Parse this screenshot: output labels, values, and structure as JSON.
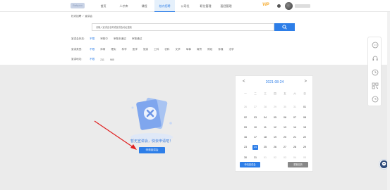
{
  "header": {
    "logo_text": "Babpoo",
    "nav": [
      "首页",
      "人才库",
      "课程",
      "校内招聘",
      "公司社",
      "职位管理",
      "面经管理"
    ],
    "active_nav_index": 3,
    "vip_label": "VIP"
  },
  "breadcrumb": [
    "校内招聘",
    "宣讲会"
  ],
  "search": {
    "placeholder": "请输入宣讲会名称或宣讲会地址搜索"
  },
  "filters": [
    {
      "label": "宣讲会状态:",
      "options": [
        "不限",
        "审核中",
        "审核未通过",
        "审核通过"
      ],
      "selected": 0
    },
    {
      "label": "宣讲类型:",
      "options": [
        "不限",
        "体育",
        "理实",
        "科学",
        "医学",
        "旅游",
        "工科",
        "农科",
        "文学",
        "军事",
        "商贸",
        "财经",
        "传媒",
        "法学"
      ],
      "selected": 0
    },
    {
      "label": "宣讲地址:",
      "options": [
        "不限",
        "211",
        "985"
      ],
      "selected": 0
    }
  ],
  "empty": {
    "message": "暂无宣讲会，快去申请吧！",
    "apply_button": "申请宣讲会"
  },
  "calendar": {
    "title": "2021-08-24",
    "prev": "<",
    "next": ">",
    "weekdays": [
      "一",
      "二",
      "三",
      "四",
      "五",
      "六",
      "日"
    ],
    "days": [
      {
        "d": "26",
        "muted": true
      },
      {
        "d": "27",
        "muted": true
      },
      {
        "d": "28",
        "muted": true
      },
      {
        "d": "29",
        "muted": true
      },
      {
        "d": "30",
        "muted": true
      },
      {
        "d": "31",
        "muted": true
      },
      {
        "d": "01"
      },
      {
        "d": "02"
      },
      {
        "d": "03"
      },
      {
        "d": "04"
      },
      {
        "d": "05"
      },
      {
        "d": "06"
      },
      {
        "d": "07"
      },
      {
        "d": "08"
      },
      {
        "d": "09"
      },
      {
        "d": "10"
      },
      {
        "d": "11"
      },
      {
        "d": "12"
      },
      {
        "d": "13"
      },
      {
        "d": "14"
      },
      {
        "d": "15"
      },
      {
        "d": "16"
      },
      {
        "d": "17"
      },
      {
        "d": "18"
      },
      {
        "d": "19"
      },
      {
        "d": "20"
      },
      {
        "d": "21"
      },
      {
        "d": "22"
      },
      {
        "d": "23"
      },
      {
        "d": "24",
        "today": true
      },
      {
        "d": "25"
      },
      {
        "d": "26"
      },
      {
        "d": "27"
      },
      {
        "d": "28"
      },
      {
        "d": "29"
      },
      {
        "d": "30"
      },
      {
        "d": "31"
      },
      {
        "d": "01",
        "muted": true
      },
      {
        "d": "02",
        "muted": true
      },
      {
        "d": "03",
        "muted": true
      },
      {
        "d": "04",
        "muted": true
      },
      {
        "d": "05",
        "muted": true
      }
    ],
    "left_button": "申请宣讲会",
    "right_button": "重置日历"
  },
  "float_icons": [
    "chat-icon",
    "headset-icon",
    "history-icon",
    "qrcode-icon",
    "clock-icon"
  ],
  "colors": {
    "accent": "#2d7ee8",
    "arrow": "#e02020"
  }
}
